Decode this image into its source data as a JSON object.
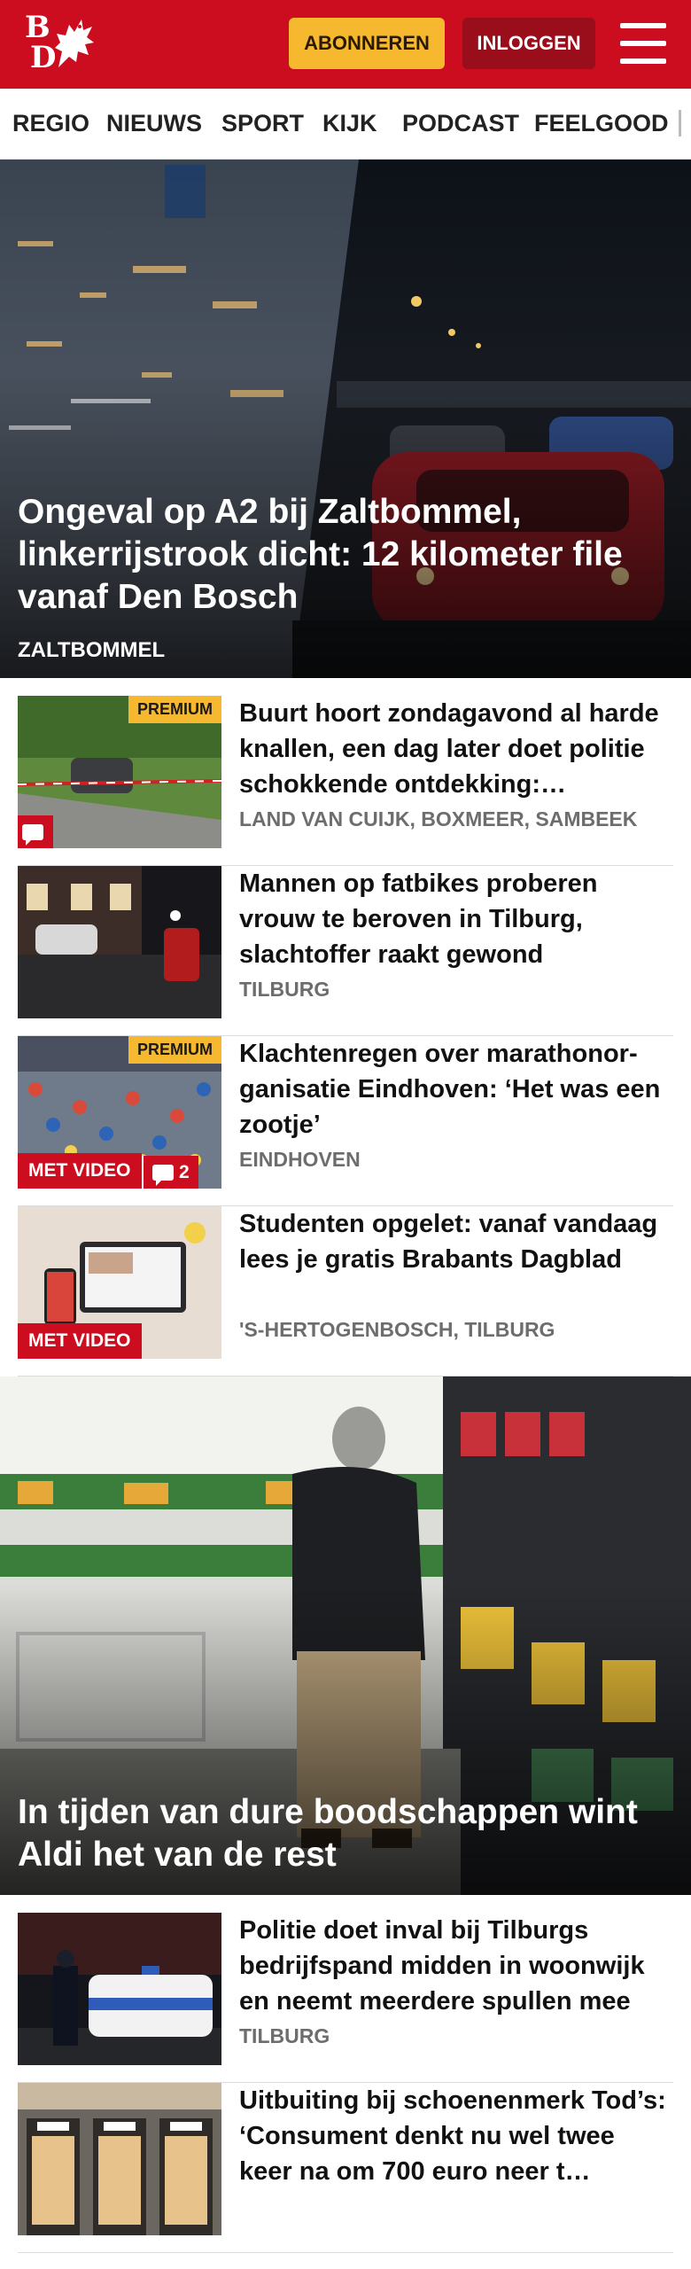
{
  "header": {
    "logo_letters": [
      "B",
      "D"
    ],
    "subscribe_label": "ABONNEREN",
    "login_label": "INLOGGEN",
    "brand_color": "#cc0d1f"
  },
  "nav": {
    "items": [
      "REGIO",
      "NIEUWS",
      "SPORT",
      "KIJK",
      "PODCAST",
      "FEELGOOD"
    ]
  },
  "hero1": {
    "title": "Ongeval op A2 bij Zaltbommel, linkerrijstrook dicht: 12 kilometer file vanaf Den Bosch",
    "location": "ZALTBOMMEL"
  },
  "articles": [
    {
      "title": "Buurt hoort zondagavond al harde knallen, een dag later doet politie schokkende ontdekking:…",
      "location": "LAND VAN CUIJK, BOXMEER, SAMBEEK",
      "premium": "PREMIUM"
    },
    {
      "title": "Mannen op fatbikes proberen vrouw te beroven in Tilburg, slachtoffer raakt gewond",
      "location": "TILBURG"
    },
    {
      "title": "Klachtenregen over marathonor­ganisatie Eindhoven: ‘Het was een zootje’",
      "location": "EINDHOVEN",
      "premium": "PREMIUM",
      "video": "MET VIDEO",
      "comments": "2"
    },
    {
      "title": "Studenten opgelet: vanaf vandaag lees je gratis Brabants Dagblad",
      "location": "'S-HERTOGENBOSCH, TILBURG",
      "video": "MET VIDEO"
    }
  ],
  "hero2": {
    "title": "In tijden van dure boodschappen wint Aldi het van de rest"
  },
  "articles2": [
    {
      "title": "Politie doet inval bij Tilburgs bedrijfspand midden in woonwijk en neemt meerdere spullen mee",
      "location": "TILBURG"
    },
    {
      "title": "Uitbuiting bij schoenenmerk Tod’s: ‘Consument denkt nu wel twee keer na om 700 euro neer t…"
    }
  ],
  "colors": {
    "premium": "#f5b82e",
    "video": "#cc0d1f",
    "location_text": "#6d6d6d"
  }
}
